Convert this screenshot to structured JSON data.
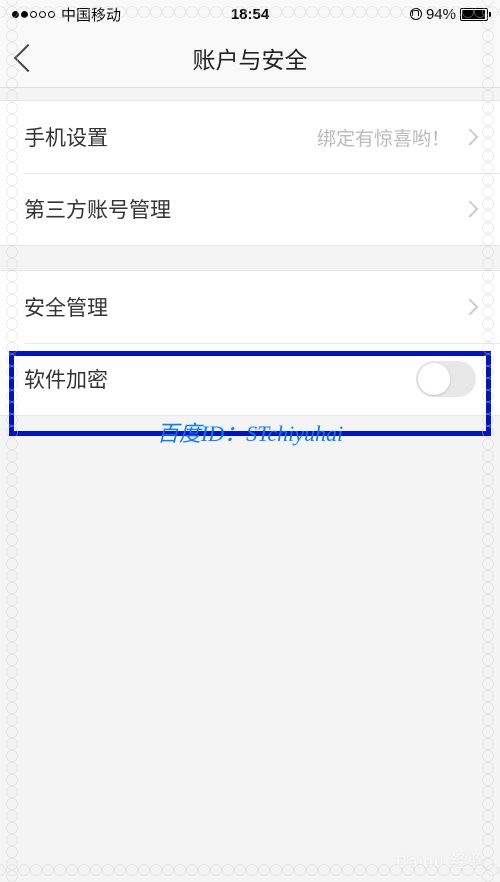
{
  "status_bar": {
    "carrier": "中国移动",
    "time": "18:54",
    "battery_percent": "94%"
  },
  "nav": {
    "title": "账户与安全"
  },
  "groups": [
    {
      "items": [
        {
          "label": "手机设置",
          "value": "绑定有惊喜哟！",
          "type": "nav"
        },
        {
          "label": "第三方账号管理",
          "value": "",
          "type": "nav"
        }
      ]
    },
    {
      "items": [
        {
          "label": "安全管理",
          "value": "",
          "type": "nav"
        },
        {
          "label": "软件加密",
          "value": "",
          "type": "toggle",
          "toggle_on": false
        }
      ]
    }
  ],
  "watermark": {
    "center_text": "百度ID：STchiyuhai",
    "footer_text": "Baidu 经验"
  }
}
